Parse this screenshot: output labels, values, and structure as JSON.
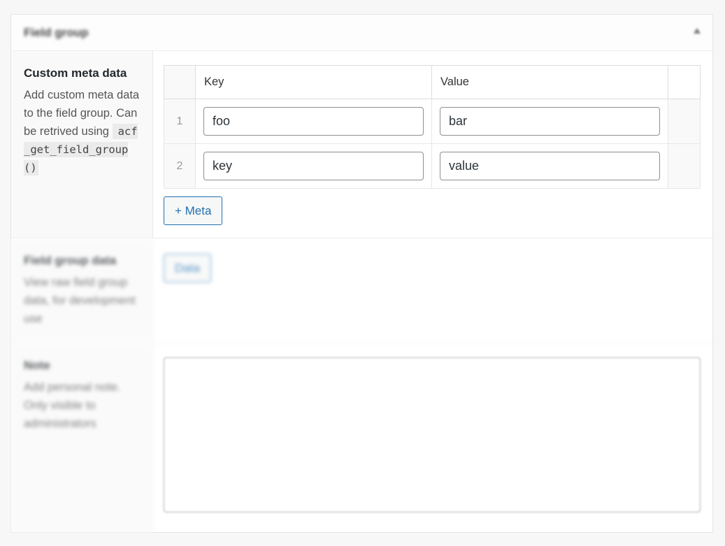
{
  "panel": {
    "title": "Field group"
  },
  "meta_section": {
    "label": "Custom meta data",
    "description": "Add custom meta data to the field group. Can be retrived using",
    "code": "acf_get_field_group()",
    "columns": [
      "Key",
      "Value"
    ],
    "rows": [
      {
        "num": "1",
        "key": "foo",
        "value": "bar"
      },
      {
        "num": "2",
        "key": "key",
        "value": "value"
      }
    ],
    "add_button": "+ Meta"
  },
  "data_section": {
    "label": "Field group data",
    "description": "View raw field group data, for development use",
    "button": "Data"
  },
  "note_section": {
    "label": "Note",
    "description": "Add personal note. Only visible to administrators"
  },
  "colors": {
    "accent": "#2271b1",
    "label_bg": "#f9f9f9"
  }
}
